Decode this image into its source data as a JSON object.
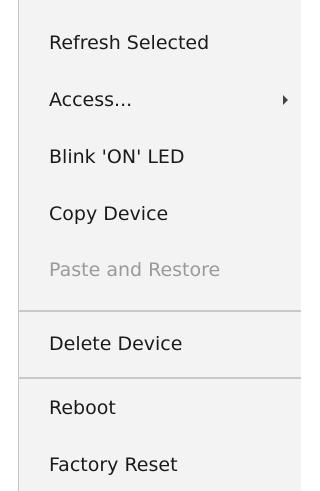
{
  "menu": {
    "items": [
      {
        "label": "Refresh Selected",
        "enabled": true
      },
      {
        "label": "Access...",
        "enabled": true,
        "submenu_icon": "chevron-right-icon"
      },
      {
        "label": "Blink 'ON' LED",
        "enabled": true
      },
      {
        "label": "Copy Device",
        "enabled": true
      },
      {
        "label": "Paste and Restore",
        "enabled": false
      },
      {
        "label": "Delete Device",
        "enabled": true
      },
      {
        "label": "Reboot",
        "enabled": true
      },
      {
        "label": "Factory Reset",
        "enabled": true
      }
    ]
  }
}
